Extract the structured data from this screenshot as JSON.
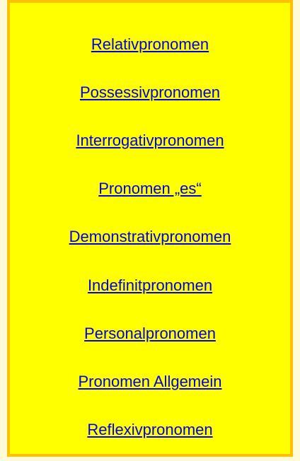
{
  "colors": {
    "page_background": "#FFFBD6",
    "box_background": "#FFFF00",
    "box_border": "#FFC000",
    "link": "#0000EE"
  },
  "nav": {
    "links": [
      {
        "label": "Relativpronomen"
      },
      {
        "label": "Possessivpronomen"
      },
      {
        "label": "Interrogativpronomen"
      },
      {
        "label": "Pronomen „es“"
      },
      {
        "label": "Demonstrativpronomen"
      },
      {
        "label": "Indefinitpronomen"
      },
      {
        "label": "Personalpronomen"
      },
      {
        "label": "Pronomen Allgemein"
      },
      {
        "label": "Reflexivpronomen"
      }
    ]
  }
}
